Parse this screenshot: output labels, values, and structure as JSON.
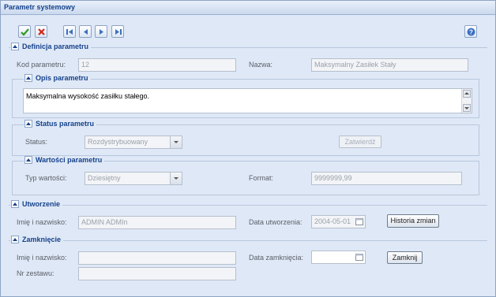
{
  "window": {
    "title": "Parametr systemowy"
  },
  "toolbar": {
    "save_icon": "check-icon",
    "cancel_icon": "x-icon",
    "nav_icons": [
      "first-icon",
      "prev-icon",
      "next-icon",
      "last-icon"
    ],
    "help_icon": "help-icon"
  },
  "definicja": {
    "legend": "Definicja parametru",
    "kod_label": "Kod parametru:",
    "kod_value": "12",
    "nazwa_label": "Nazwa:",
    "nazwa_value": "Maksymalny Zasiłek Stały"
  },
  "opis": {
    "legend": "Opis parametru",
    "text": "Maksymalna wysokość zasiłku stałego."
  },
  "status": {
    "legend": "Status parametru",
    "status_label": "Status:",
    "status_value": "Rozdystrybuowany",
    "zatwierdz_label": "Zatwierdź"
  },
  "wartosci": {
    "legend": "Wartości parametru",
    "typ_label": "Typ wartości:",
    "typ_value": "Dziesiętny",
    "format_label": "Format:",
    "format_value": "9999999,99"
  },
  "utworzenie": {
    "legend": "Utworzenie",
    "imie_label": "Imię i nazwisko:",
    "imie_value": "ADMIN ADMIn",
    "data_label": "Data utworzenia:",
    "data_value": "2004-05-01",
    "historia_label": "Historia zmian"
  },
  "zamkniecie": {
    "legend": "Zamknięcie",
    "imie_label": "Imię i nazwisko:",
    "imie_value": "",
    "data_label": "Data zamknięcia:",
    "data_value": "",
    "zamknij_label": "Zamknij",
    "nr_label": "Nr zestawu:",
    "nr_value": ""
  },
  "colors": {
    "accent": "#15428b",
    "panel": "#dfe8f6",
    "border": "#b7c7df"
  }
}
